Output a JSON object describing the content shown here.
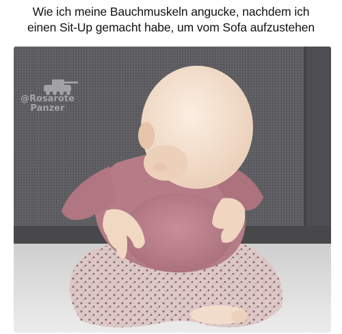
{
  "caption": {
    "line1": "Wie ich meine Bauchmuskeln angucke, nachdem ich",
    "line2": "einen Sit-Up gemacht habe, um vom Sofa aufzustehen"
  },
  "watermark": {
    "handle": "@Rosarote",
    "name": "Panzer"
  },
  "colors": {
    "sofa": "#5f5f63",
    "floor": "#dcdcdc",
    "shirt": "#b47a86",
    "skin": "#f1d8c2",
    "pants": "#d8c4c2"
  },
  "icons": {
    "watermark_logo": "tank-icon"
  }
}
